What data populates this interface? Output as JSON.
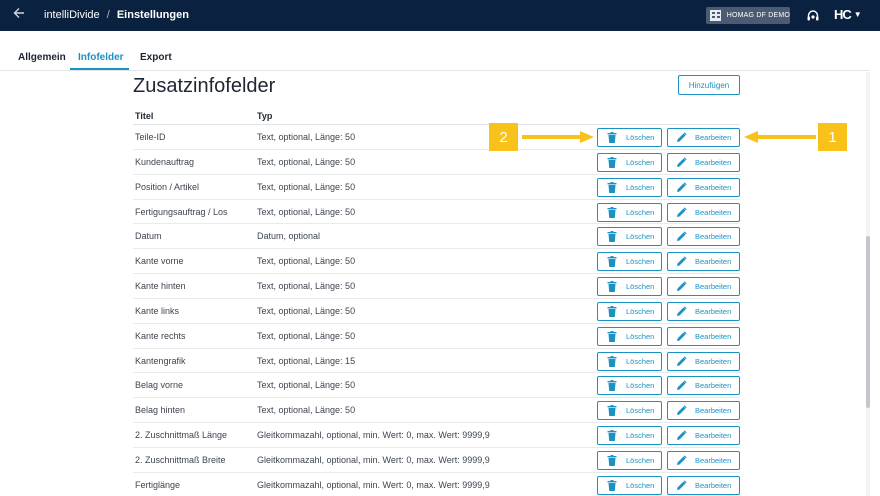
{
  "header": {
    "app_name": "intelliDivide",
    "separator": "/",
    "page": "Einstellungen",
    "tenant": "HOMAG DF DEMO",
    "logo": "HC",
    "icons": {
      "back": "arrow-left-icon",
      "tenant": "building-icon",
      "support": "headset-icon",
      "menu": "caret-down-icon"
    }
  },
  "tabs": [
    {
      "label": "Allgemein"
    },
    {
      "label": "Infofelder"
    },
    {
      "label": "Export"
    }
  ],
  "main": {
    "title": "Zusatzinfofelder",
    "add_label": "Hinzufügen",
    "columns": {
      "title": "Titel",
      "type": "Typ"
    },
    "delete_label": "Löschen",
    "edit_label": "Bearbeiten",
    "rows": [
      {
        "title": "Teile-ID",
        "type": "Text, optional, Länge: 50"
      },
      {
        "title": "Kundenauftrag",
        "type": "Text, optional, Länge: 50"
      },
      {
        "title": "Position / Artikel",
        "type": "Text, optional, Länge: 50"
      },
      {
        "title": "Fertigungsauftrag / Los",
        "type": "Text, optional, Länge: 50"
      },
      {
        "title": "Datum",
        "type": "Datum, optional"
      },
      {
        "title": "Kante vorne",
        "type": "Text, optional, Länge: 50"
      },
      {
        "title": "Kante hinten",
        "type": "Text, optional, Länge: 50"
      },
      {
        "title": "Kante links",
        "type": "Text, optional, Länge: 50"
      },
      {
        "title": "Kante rechts",
        "type": "Text, optional, Länge: 50"
      },
      {
        "title": "Kantengrafik",
        "type": "Text, optional, Länge: 15"
      },
      {
        "title": "Belag vorne",
        "type": "Text, optional, Länge: 50"
      },
      {
        "title": "Belag hinten",
        "type": "Text, optional, Länge: 50"
      },
      {
        "title": "2. Zuschnittmaß Länge",
        "type": "Gleitkommazahl, optional, min. Wert: 0, max. Wert: 9999,9"
      },
      {
        "title": "2. Zuschnittmaß Breite",
        "type": "Gleitkommazahl, optional, min. Wert: 0, max. Wert: 9999,9"
      },
      {
        "title": "Fertiglänge",
        "type": "Gleitkommazahl, optional, min. Wert: 0, max. Wert: 9999,9"
      }
    ]
  },
  "annotations": [
    {
      "label": "2"
    },
    {
      "label": "1"
    }
  ],
  "colors": {
    "header_bg": "#0a2240",
    "accent": "#1a93c4",
    "annotation": "#f8c21a"
  }
}
